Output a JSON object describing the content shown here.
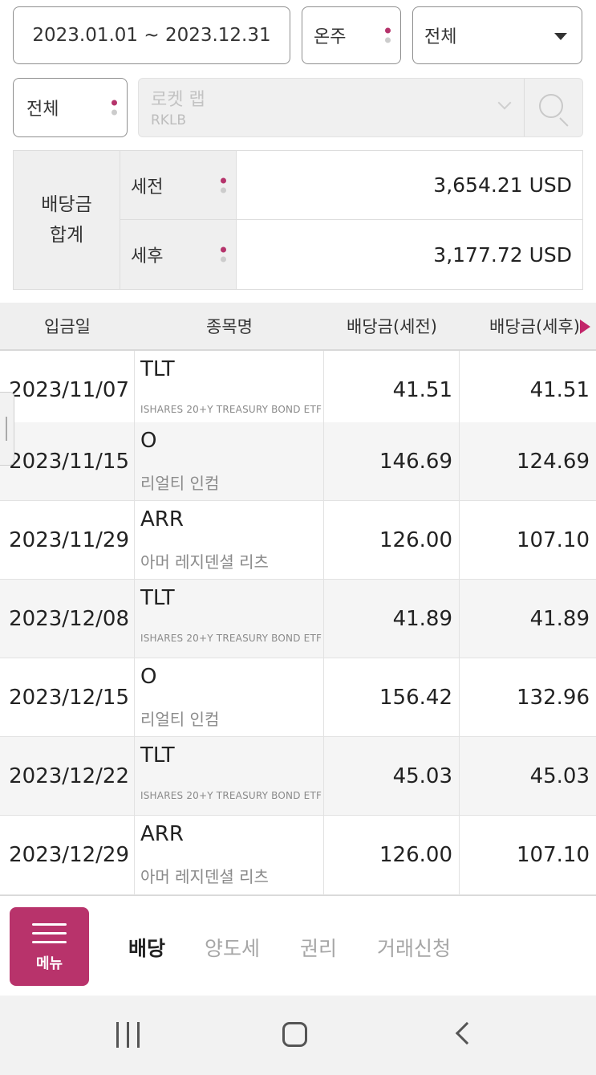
{
  "filters": {
    "date_range": "2023.01.01 ~ 2023.12.31",
    "period_select": "온주",
    "type_select": "전체",
    "account_filter": "전체"
  },
  "stock_search": {
    "name": "로켓 랩",
    "code": "RKLB"
  },
  "summary": {
    "title_line1": "배당금",
    "title_line2": "합계",
    "pre_tax_label": "세전",
    "pre_tax_value": "3,654.21 USD",
    "post_tax_label": "세후",
    "post_tax_value": "3,177.72 USD"
  },
  "table": {
    "headers": {
      "date": "입금일",
      "stock": "종목명",
      "pre_tax": "배당금(세전)",
      "post_tax": "배당금(세후)"
    },
    "rows": [
      {
        "date": "2023/11/07",
        "ticker": "TLT",
        "name": "ISHARES 20+Y TREASURY BOND ETF",
        "pre": "41.51",
        "post": "41.51"
      },
      {
        "date": "2023/11/15",
        "ticker": "O",
        "name": "리얼티 인컴",
        "pre": "146.69",
        "post": "124.69"
      },
      {
        "date": "2023/11/29",
        "ticker": "ARR",
        "name": "아머 레지덴셜 리츠",
        "pre": "126.00",
        "post": "107.10"
      },
      {
        "date": "2023/12/08",
        "ticker": "TLT",
        "name": "ISHARES 20+Y TREASURY BOND ETF",
        "pre": "41.89",
        "post": "41.89"
      },
      {
        "date": "2023/12/15",
        "ticker": "O",
        "name": "리얼티 인컴",
        "pre": "156.42",
        "post": "132.96"
      },
      {
        "date": "2023/12/22",
        "ticker": "TLT",
        "name": "ISHARES 20+Y TREASURY BOND ETF",
        "pre": "45.03",
        "post": "45.03"
      },
      {
        "date": "2023/12/29",
        "ticker": "ARR",
        "name": "아머 레지덴셜 리츠",
        "pre": "126.00",
        "post": "107.10"
      }
    ]
  },
  "bottom_nav": {
    "menu_label": "메뉴",
    "tabs": [
      "배당",
      "양도세",
      "권리",
      "거래신청"
    ],
    "active_tab": "배당"
  },
  "colors": {
    "accent": "#b8336b",
    "header_bg": "#efefef",
    "row_alt_bg": "#f5f5f5"
  },
  "icons": {
    "search": "search-icon",
    "dropdown": "chevron-down-icon",
    "scroll_right": "arrow-right-icon",
    "menu": "hamburger-icon",
    "nav_recent": "recent-apps-icon",
    "nav_home": "home-icon",
    "nav_back": "back-icon"
  }
}
